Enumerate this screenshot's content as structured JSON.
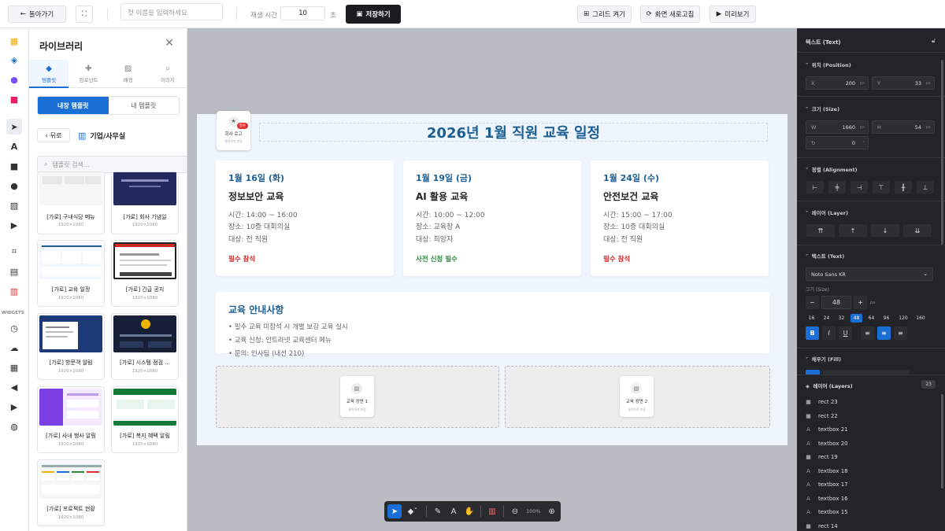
{
  "topbar": {
    "back_label": "돌아가기",
    "cut_placeholder": "컷 이름을 입력하세요",
    "playtime_label": "재생 시간",
    "playtime_value": "10",
    "playtime_unit": "초",
    "save_label": "저장하기",
    "grid_label": "그리드 켜기",
    "refresh_label": "화면 새로고침",
    "preview_label": "미리보기"
  },
  "iconbar": {
    "widgets_label": "WIDGETS"
  },
  "library": {
    "title": "라이브러리",
    "tabs": [
      {
        "label": "템플릿",
        "icon": "shapes-icon"
      },
      {
        "label": "컴포넌트",
        "icon": "puzzle-icon"
      },
      {
        "label": "배경",
        "icon": "image-icon"
      },
      {
        "label": "이미지",
        "icon": "search-icon"
      }
    ],
    "seg_builtin": "내장 템플릿",
    "seg_mine": "내 템플릿",
    "back_label": "뒤로",
    "category": "기업/사무실",
    "search_placeholder": "템플릿 검색...",
    "templates": [
      {
        "name": "[가로] 구내식당 메뉴",
        "size": "1920×1080"
      },
      {
        "name": "[가로] 회사 기념일",
        "size": "1920×1080"
      },
      {
        "name": "[가로] 교육 일정",
        "size": "1920×1080"
      },
      {
        "name": "[가로] 긴급 공지",
        "size": "1920×1080"
      },
      {
        "name": "[가로] 방문객 알림",
        "size": "1920×1080"
      },
      {
        "name": "[가로] 시스템 점검 ...",
        "size": "1920×1080"
      },
      {
        "name": "[가로] 사내 행사 알림",
        "size": "1920×1080"
      },
      {
        "name": "[가로] 복지 혜택 알림",
        "size": "1920×1080"
      },
      {
        "name": "[가로] 프로젝트 현황",
        "size": "1920×1080"
      }
    ]
  },
  "canvas": {
    "title": "2026년 1월 직원 교육 일정",
    "logo": {
      "badge": "필수",
      "title": "회사 로고",
      "sub": "클릭하여 변경"
    },
    "events": [
      {
        "date": "1월 16일 (화)",
        "title": "정보보안 교육",
        "time": "시간: 14:00 ~ 16:00",
        "place": "장소: 10층 대회의실",
        "target": "대상: 전 직원",
        "tag": "필수 참석",
        "tag_color": "#c92a2a"
      },
      {
        "date": "1월 19일 (금)",
        "title": "AI 활용 교육",
        "time": "시간: 10:00 ~ 12:00",
        "place": "장소: 교육장 A",
        "target": "대상: 희망자",
        "tag": "사전 신청 필수",
        "tag_color": "#2b8a3e"
      },
      {
        "date": "1월 24일 (수)",
        "title": "안전보건 교육",
        "time": "시간: 15:00 ~ 17:00",
        "place": "장소: 10층 대회의실",
        "target": "대상: 전 직원",
        "tag": "필수 참석",
        "tag_color": "#c92a2a"
      }
    ],
    "notice": {
      "title": "교육 안내사항",
      "lines": [
        "• 필수 교육 미참석 시 개별 보강 교육 실시",
        "• 교육 신청: 인트라넷 교육센터 메뉴",
        "• 문의: 인사팀 (내선 210)"
      ]
    },
    "placeholders": [
      {
        "title": "교육 장면 1",
        "sub": "클릭하여 변경"
      },
      {
        "title": "교육 장면 2",
        "sub": "클릭하여 변경"
      }
    ]
  },
  "toolbar": {
    "zoom": "100%"
  },
  "props": {
    "header": "텍스트 (Text)",
    "position_label": "위치 (Position)",
    "x_key": "X",
    "x_value": "200",
    "y_key": "Y",
    "y_value": "33",
    "px_unit": "px",
    "size_label": "크기 (Size)",
    "w_key": "W",
    "w_value": "1660",
    "h_key": "H",
    "h_value": "54",
    "rotate_value": "0",
    "rotate_unit": "°",
    "align_label": "정렬 (Alignment)",
    "layer_label": "레이어 (Layer)",
    "text_label": "텍스트 (Text)",
    "font_value": "Noto Sans KR",
    "font_size_label": "크기 (Size)",
    "font_size_value": "48",
    "font_size_unit": "px",
    "presets": [
      "16",
      "24",
      "32",
      "48",
      "64",
      "96",
      "120",
      "160"
    ],
    "preset_active": "48",
    "fill_label": "채우기 (Fill)",
    "accent": "#1a6fd6"
  },
  "layers": {
    "title": "레이어 (Layers)",
    "count": "23",
    "items": [
      {
        "glyph": "■",
        "name": "rect 23"
      },
      {
        "glyph": "■",
        "name": "rect 22"
      },
      {
        "glyph": "A",
        "name": "textbox 21"
      },
      {
        "glyph": "A",
        "name": "textbox 20"
      },
      {
        "glyph": "■",
        "name": "rect 19"
      },
      {
        "glyph": "A",
        "name": "textbox 18"
      },
      {
        "glyph": "A",
        "name": "textbox 17"
      },
      {
        "glyph": "A",
        "name": "textbox 16"
      },
      {
        "glyph": "A",
        "name": "textbox 15"
      },
      {
        "glyph": "■",
        "name": "rect 14"
      }
    ]
  }
}
